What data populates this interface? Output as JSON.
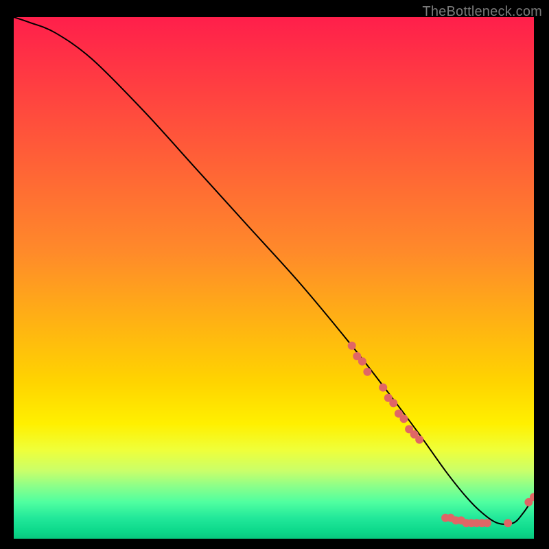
{
  "watermark": "TheBottleneck.com",
  "colors": {
    "background": "#000000",
    "curve": "#000000",
    "marker": "#e06666",
    "gradient_stops": [
      {
        "offset": 0.0,
        "color": "#ff1f4b"
      },
      {
        "offset": 0.45,
        "color": "#ff8a2a"
      },
      {
        "offset": 0.7,
        "color": "#ffd400"
      },
      {
        "offset": 0.78,
        "color": "#fff000"
      },
      {
        "offset": 0.83,
        "color": "#efff3a"
      },
      {
        "offset": 0.87,
        "color": "#c9ff6a"
      },
      {
        "offset": 0.9,
        "color": "#8aff8a"
      },
      {
        "offset": 0.93,
        "color": "#4fffa0"
      },
      {
        "offset": 0.96,
        "color": "#22e89a"
      },
      {
        "offset": 0.985,
        "color": "#0dd98b"
      },
      {
        "offset": 1.0,
        "color": "#08c97f"
      }
    ]
  },
  "chart_data": {
    "type": "line",
    "title": "",
    "xlabel": "",
    "ylabel": "",
    "xlim": [
      0,
      100
    ],
    "ylim": [
      0,
      100
    ],
    "series": [
      {
        "name": "curve",
        "x": [
          0,
          3,
          8,
          15,
          25,
          35,
          45,
          55,
          65,
          72,
          78,
          83,
          87,
          90,
          93,
          96,
          98,
          100
        ],
        "y": [
          100,
          99,
          97,
          92,
          82,
          71,
          60,
          49,
          37,
          28,
          20,
          13,
          8,
          5,
          3,
          3,
          5,
          8
        ]
      }
    ],
    "markers": [
      {
        "x": 65,
        "y": 37
      },
      {
        "x": 66,
        "y": 35
      },
      {
        "x": 67,
        "y": 34
      },
      {
        "x": 68,
        "y": 32
      },
      {
        "x": 71,
        "y": 29
      },
      {
        "x": 72,
        "y": 27
      },
      {
        "x": 73,
        "y": 26
      },
      {
        "x": 74,
        "y": 24
      },
      {
        "x": 75,
        "y": 23
      },
      {
        "x": 76,
        "y": 21
      },
      {
        "x": 77,
        "y": 20
      },
      {
        "x": 78,
        "y": 19
      },
      {
        "x": 83,
        "y": 4
      },
      {
        "x": 84,
        "y": 4
      },
      {
        "x": 85,
        "y": 3.5
      },
      {
        "x": 86,
        "y": 3.5
      },
      {
        "x": 87,
        "y": 3
      },
      {
        "x": 88,
        "y": 3
      },
      {
        "x": 89,
        "y": 3
      },
      {
        "x": 90,
        "y": 3
      },
      {
        "x": 91,
        "y": 3
      },
      {
        "x": 95,
        "y": 3
      },
      {
        "x": 99,
        "y": 7
      },
      {
        "x": 100,
        "y": 8
      }
    ]
  }
}
